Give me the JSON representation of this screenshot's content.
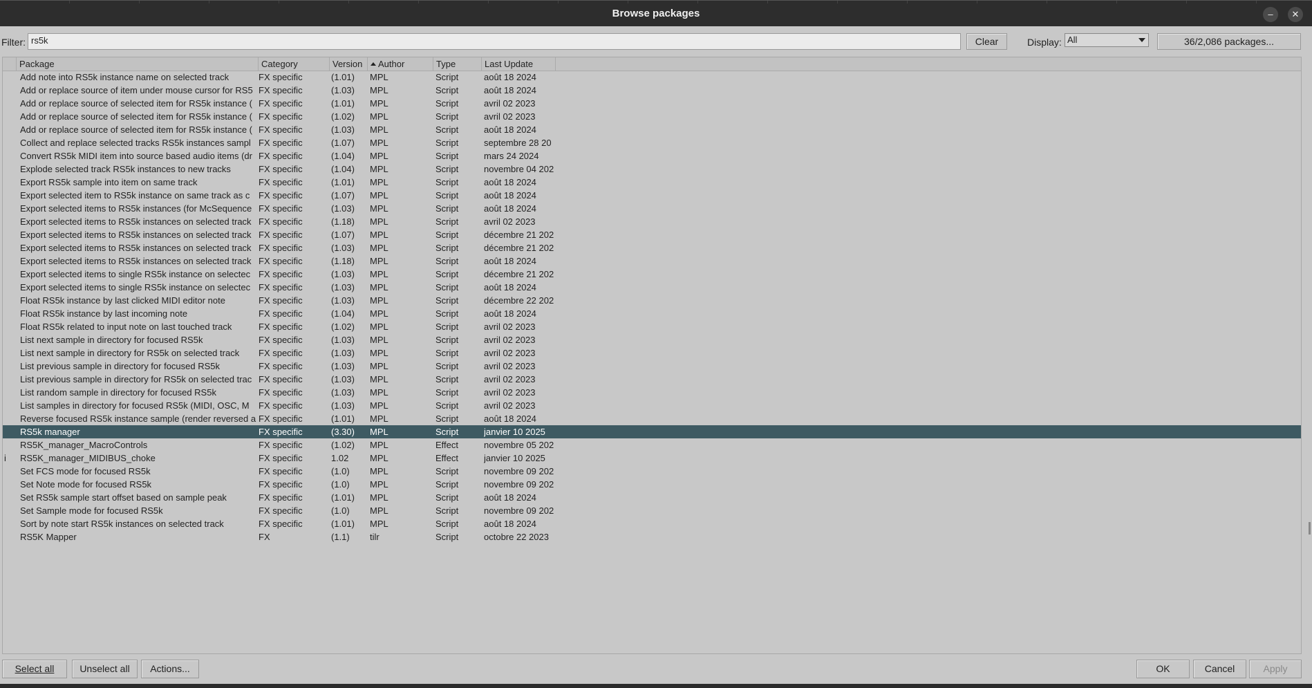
{
  "window": {
    "title": "Browse packages"
  },
  "filter": {
    "label": "Filter:",
    "value": "rs5k",
    "clear_label": "Clear"
  },
  "display": {
    "label": "Display:",
    "selected": "All",
    "count_button": "36/2,086 packages..."
  },
  "columns": [
    "Package",
    "Category",
    "Version",
    "Author",
    "Type",
    "Last Update"
  ],
  "rows": [
    {
      "flag": "",
      "package": "Add note into RS5k instance name on selected track",
      "category": "FX specific",
      "version": "(1.01)",
      "author": "MPL",
      "type": "Script",
      "updated": "août 18 2024"
    },
    {
      "flag": "",
      "package": "Add or replace source of item under mouse cursor for RS5",
      "category": "FX specific",
      "version": "(1.03)",
      "author": "MPL",
      "type": "Script",
      "updated": "août 18 2024"
    },
    {
      "flag": "",
      "package": "Add or replace source of selected item for RS5k instance (",
      "category": "FX specific",
      "version": "(1.01)",
      "author": "MPL",
      "type": "Script",
      "updated": "avril 02 2023"
    },
    {
      "flag": "",
      "package": "Add or replace source of selected item for RS5k instance (",
      "category": "FX specific",
      "version": "(1.02)",
      "author": "MPL",
      "type": "Script",
      "updated": "avril 02 2023"
    },
    {
      "flag": "",
      "package": "Add or replace source of selected item for RS5k instance (",
      "category": "FX specific",
      "version": "(1.03)",
      "author": "MPL",
      "type": "Script",
      "updated": "août 18 2024"
    },
    {
      "flag": "",
      "package": "Collect and replace selected tracks RS5k instances sampl",
      "category": "FX specific",
      "version": "(1.07)",
      "author": "MPL",
      "type": "Script",
      "updated": "septembre 28 20"
    },
    {
      "flag": "",
      "package": "Convert RS5k MIDI item into source based audio items (dr",
      "category": "FX specific",
      "version": "(1.04)",
      "author": "MPL",
      "type": "Script",
      "updated": "mars 24 2024"
    },
    {
      "flag": "",
      "package": "Explode selected track RS5k instances to new tracks",
      "category": "FX specific",
      "version": "(1.04)",
      "author": "MPL",
      "type": "Script",
      "updated": "novembre 04 202"
    },
    {
      "flag": "",
      "package": "Export RS5k sample into item on same track",
      "category": "FX specific",
      "version": "(1.01)",
      "author": "MPL",
      "type": "Script",
      "updated": "août 18 2024"
    },
    {
      "flag": "",
      "package": "Export selected item to RS5k instance on same track as c",
      "category": "FX specific",
      "version": "(1.07)",
      "author": "MPL",
      "type": "Script",
      "updated": "août 18 2024"
    },
    {
      "flag": "",
      "package": "Export selected items to RS5k instances (for McSequence",
      "category": "FX specific",
      "version": "(1.03)",
      "author": "MPL",
      "type": "Script",
      "updated": "août 18 2024"
    },
    {
      "flag": "",
      "package": "Export selected items to RS5k instances on selected track",
      "category": "FX specific",
      "version": "(1.18)",
      "author": "MPL",
      "type": "Script",
      "updated": "avril 02 2023"
    },
    {
      "flag": "",
      "package": "Export selected items to RS5k instances on selected track",
      "category": "FX specific",
      "version": "(1.07)",
      "author": "MPL",
      "type": "Script",
      "updated": "décembre 21 202"
    },
    {
      "flag": "",
      "package": "Export selected items to RS5k instances on selected track",
      "category": "FX specific",
      "version": "(1.03)",
      "author": "MPL",
      "type": "Script",
      "updated": "décembre 21 202"
    },
    {
      "flag": "",
      "package": "Export selected items to RS5k instances on selected track",
      "category": "FX specific",
      "version": "(1.18)",
      "author": "MPL",
      "type": "Script",
      "updated": "août 18 2024"
    },
    {
      "flag": "",
      "package": "Export selected items to single RS5k instance on selectec",
      "category": "FX specific",
      "version": "(1.03)",
      "author": "MPL",
      "type": "Script",
      "updated": "décembre 21 202"
    },
    {
      "flag": "",
      "package": "Export selected items to single RS5k instance on selectec",
      "category": "FX specific",
      "version": "(1.03)",
      "author": "MPL",
      "type": "Script",
      "updated": "août 18 2024"
    },
    {
      "flag": "",
      "package": "Float RS5k instance by last clicked MIDI editor note",
      "category": "FX specific",
      "version": "(1.03)",
      "author": "MPL",
      "type": "Script",
      "updated": "décembre 22 202"
    },
    {
      "flag": "",
      "package": "Float RS5k instance by last incoming note",
      "category": "FX specific",
      "version": "(1.04)",
      "author": "MPL",
      "type": "Script",
      "updated": "août 18 2024"
    },
    {
      "flag": "",
      "package": "Float RS5k related to input note on last touched track",
      "category": "FX specific",
      "version": "(1.02)",
      "author": "MPL",
      "type": "Script",
      "updated": "avril 02 2023"
    },
    {
      "flag": "",
      "package": "List next sample in directory for focused RS5k",
      "category": "FX specific",
      "version": "(1.03)",
      "author": "MPL",
      "type": "Script",
      "updated": "avril 02 2023"
    },
    {
      "flag": "",
      "package": "List next sample in directory for RS5k on selected track",
      "category": "FX specific",
      "version": "(1.03)",
      "author": "MPL",
      "type": "Script",
      "updated": "avril 02 2023"
    },
    {
      "flag": "",
      "package": "List previous sample in directory for focused RS5k",
      "category": "FX specific",
      "version": "(1.03)",
      "author": "MPL",
      "type": "Script",
      "updated": "avril 02 2023"
    },
    {
      "flag": "",
      "package": "List previous sample in directory for RS5k on selected trac",
      "category": "FX specific",
      "version": "(1.03)",
      "author": "MPL",
      "type": "Script",
      "updated": "avril 02 2023"
    },
    {
      "flag": "",
      "package": "List random sample in directory for focused RS5k",
      "category": "FX specific",
      "version": "(1.03)",
      "author": "MPL",
      "type": "Script",
      "updated": "avril 02 2023"
    },
    {
      "flag": "",
      "package": "List samples in directory for focused RS5k (MIDI, OSC, M",
      "category": "FX specific",
      "version": "(1.03)",
      "author": "MPL",
      "type": "Script",
      "updated": "avril 02 2023"
    },
    {
      "flag": "",
      "package": "Reverse focused RS5k instance sample (render reversed a",
      "category": "FX specific",
      "version": "(1.01)",
      "author": "MPL",
      "type": "Script",
      "updated": "août 18 2024"
    },
    {
      "flag": "",
      "package": "RS5k manager",
      "category": "FX specific",
      "version": "(3.30)",
      "author": "MPL",
      "type": "Script",
      "updated": "janvier 10 2025",
      "selected": true
    },
    {
      "flag": "",
      "package": "RS5K_manager_MacroControls",
      "category": "FX specific",
      "version": "(1.02)",
      "author": "MPL",
      "type": "Effect",
      "updated": "novembre 05 202"
    },
    {
      "flag": "i",
      "package": "RS5K_manager_MIDIBUS_choke",
      "category": "FX specific",
      "version": "1.02",
      "author": "MPL",
      "type": "Effect",
      "updated": "janvier 10 2025"
    },
    {
      "flag": "",
      "package": "Set FCS mode for focused RS5k",
      "category": "FX specific",
      "version": "(1.0)",
      "author": "MPL",
      "type": "Script",
      "updated": "novembre 09 202"
    },
    {
      "flag": "",
      "package": "Set Note mode for focused RS5k",
      "category": "FX specific",
      "version": "(1.0)",
      "author": "MPL",
      "type": "Script",
      "updated": "novembre 09 202"
    },
    {
      "flag": "",
      "package": "Set RS5k sample start offset based on sample peak",
      "category": "FX specific",
      "version": "(1.01)",
      "author": "MPL",
      "type": "Script",
      "updated": "août 18 2024"
    },
    {
      "flag": "",
      "package": "Set Sample mode for focused RS5k",
      "category": "FX specific",
      "version": "(1.0)",
      "author": "MPL",
      "type": "Script",
      "updated": "novembre 09 202"
    },
    {
      "flag": "",
      "package": "Sort by note start RS5k instances on selected track",
      "category": "FX specific",
      "version": "(1.01)",
      "author": "MPL",
      "type": "Script",
      "updated": "août 18 2024"
    },
    {
      "flag": "",
      "package": "RS5K Mapper",
      "category": "FX",
      "version": "(1.1)",
      "author": "tilr",
      "type": "Script",
      "updated": "octobre 22 2023"
    }
  ],
  "footer": {
    "select_all": "Select all",
    "unselect_all": "Unselect all",
    "actions": "Actions...",
    "ok": "OK",
    "cancel": "Cancel",
    "apply": "Apply"
  },
  "colors": {
    "selected_row": "#3e5a62",
    "dialog_bg": "#c8c8c8",
    "titlebar_bg": "#2d2d2d"
  }
}
